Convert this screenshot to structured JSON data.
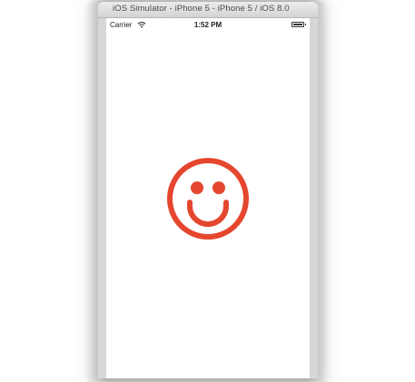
{
  "window": {
    "title": "iOS Simulator - iPhone 5 - iPhone 5 / iOS 8.0"
  },
  "status_bar": {
    "carrier": "Carrier",
    "time": "1:52 PM",
    "battery_level": 1.0,
    "icons": [
      "wifi-icon",
      "battery-icon"
    ]
  },
  "content": {
    "icon": "smiley-face-icon",
    "icon_color": "#e5462e"
  },
  "colors": {
    "accent": "#e5462e",
    "screen_background": "#ffffff"
  }
}
